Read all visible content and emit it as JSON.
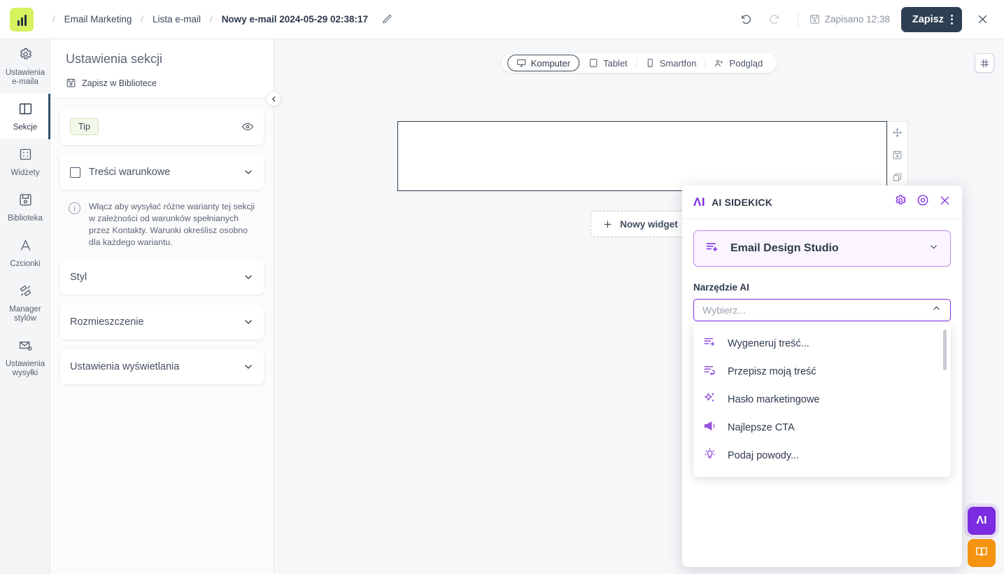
{
  "topbar": {
    "logo_icon": "bar-chart-logo",
    "breadcrumbs": [
      {
        "label": "Email Marketing"
      },
      {
        "label": "Lista e-mail"
      },
      {
        "label": "Nowy e-mail 2024-05-29 02:38:17"
      }
    ],
    "separator": "/",
    "edit_icon": "pencil-icon",
    "undo_icon": "undo-icon",
    "redo_icon": "redo-icon",
    "save_status_icon": "floppy-disk-icon",
    "save_status": "Zapisano 12:38",
    "save_label": "Zapisz",
    "kebab_icon": "kebab-menu-icon",
    "close_icon": "close-icon"
  },
  "rail": {
    "items": [
      {
        "icon": "gear-icon",
        "label": "Ustawienia e-maila",
        "active": false
      },
      {
        "icon": "columns-icon",
        "label": "Sekcje",
        "active": true
      },
      {
        "icon": "widgets-grid-icon",
        "label": "Widżety",
        "active": false
      },
      {
        "icon": "floppy-disk-icon",
        "label": "Biblioteka",
        "active": false
      },
      {
        "icon": "font-letter-icon",
        "label": "Czcionki",
        "active": false
      },
      {
        "icon": "brushes-icon",
        "label": "Manager stylów",
        "active": false
      },
      {
        "icon": "envelope-gear-icon",
        "label": "Ustawienia wysyłki",
        "active": false
      }
    ]
  },
  "panel": {
    "title": "Ustawienia sekcji",
    "save_library_icon": "floppy-disk-icon",
    "save_library_label": "Zapisz w Bibliotece",
    "collapse_icon": "chevron-left-icon",
    "tip_badge": "Tip",
    "eye_icon": "eye-icon",
    "conditional": {
      "label": "Treści warunkowe",
      "checkbox_icon": "checkbox-unchecked-icon",
      "chevron_icon": "chevron-down-icon"
    },
    "hint_icon": "info-icon",
    "hint_text": "Włącz aby wysyłać różne warianty tej sekcji w zależności od warunków spełnianych przez Kontakty. Warunki określisz osobno dla każdego wariantu.",
    "accordions": [
      {
        "label": "Styl",
        "chevron_icon": "chevron-down-icon"
      },
      {
        "label": "Rozmieszczenie",
        "chevron_icon": "chevron-down-icon"
      },
      {
        "label": "Ustawienia wyświetlania",
        "chevron_icon": "chevron-down-icon"
      }
    ]
  },
  "canvas": {
    "devices": [
      {
        "label": "Komputer",
        "icon": "desktop-icon",
        "active": true
      },
      {
        "label": "Tablet",
        "icon": "tablet-icon",
        "active": false
      },
      {
        "label": "Smartfon",
        "icon": "smartphone-icon",
        "active": false
      },
      {
        "label": "Podgląd",
        "icon": "preview-people-icon",
        "active": false
      }
    ],
    "grid_toggle_icon": "grid-layout-icon",
    "section_tools": [
      {
        "icon": "move-arrows-icon"
      },
      {
        "icon": "floppy-disk-icon"
      },
      {
        "icon": "duplicate-icon"
      }
    ],
    "new_widget_icon": "plus-icon",
    "new_widget_label": "Nowy widget"
  },
  "sidekick": {
    "logo_icon": "ai-logo-icon",
    "logo_text": "ΛI",
    "title": "AI SIDEKICK",
    "settings_icon": "gear-icon",
    "target_icon": "target-icon",
    "close_icon": "close-icon",
    "studio": {
      "icon": "list-plus-icon",
      "label": "Email Design Studio",
      "chevron_icon": "chevron-down-icon"
    },
    "tool_field": {
      "label": "Narzędzie AI",
      "placeholder": "Wybierz...",
      "value": "",
      "chevron_icon": "chevron-up-icon"
    },
    "options": [
      {
        "label": "Wygeneruj treść...",
        "icon": "list-plus-icon"
      },
      {
        "label": "Przepisz moją treść",
        "icon": "list-refresh-icon"
      },
      {
        "label": "Hasło marketingowe",
        "icon": "sparkles-icon"
      },
      {
        "label": "Najlepsze CTA",
        "icon": "megaphone-icon"
      },
      {
        "label": "Podaj powody...",
        "icon": "lightbulb-icon"
      }
    ]
  },
  "fabs": [
    {
      "name": "ai-sidekick-fab",
      "icon": "ai-logo-icon",
      "label": "ΛI",
      "color": "#7b2be0"
    },
    {
      "name": "knowledge-book-fab",
      "icon": "open-book-icon",
      "label": "",
      "color": "#f59410"
    }
  ],
  "colors": {
    "brand_lime": "#d6f25e",
    "ai_purple": "#7b2be0",
    "save_navy": "#2e3f52",
    "book_orange": "#f59410"
  }
}
